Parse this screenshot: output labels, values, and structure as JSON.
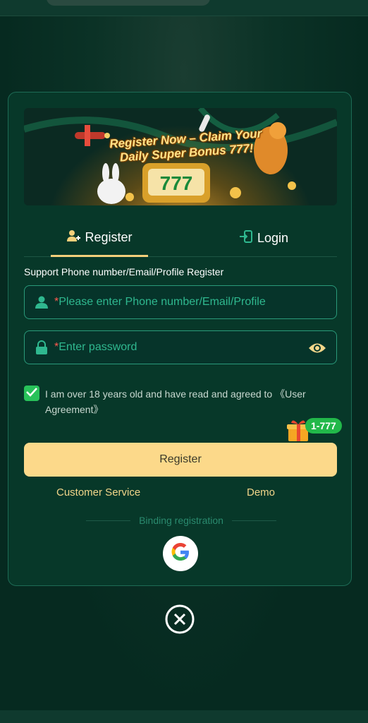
{
  "banner": {
    "headline": "Register Now – Claim Your Daily Super Bonus 777!"
  },
  "tabs": {
    "register_label": "Register",
    "login_label": "Login",
    "active": "Register"
  },
  "form": {
    "support_label": "Support Phone number/Email/Profile Register",
    "account_required_mark": "*",
    "account_placeholder": "Please enter Phone number/Email/Profile",
    "password_required_mark": "*",
    "password_placeholder": "Enter password",
    "agreement_text": "I am over 18 years old and have read and agreed to 《User Agreement》",
    "agreement_checked": true,
    "register_button": "Register"
  },
  "bonus_badge": "1-777",
  "links": {
    "customer_service": "Customer Service",
    "demo": "Demo"
  },
  "binding_label": "Binding registration",
  "colors": {
    "accent": "#fcd98a",
    "field_border": "#2a9a7a",
    "placeholder": "#2fb88f",
    "required": "#ff5a4f",
    "check": "#28c25a"
  },
  "icons": [
    "user-add-icon",
    "login-door-icon",
    "user-icon",
    "lock-icon",
    "eye-icon",
    "check-icon",
    "gift-icon",
    "google-icon",
    "close-icon"
  ]
}
